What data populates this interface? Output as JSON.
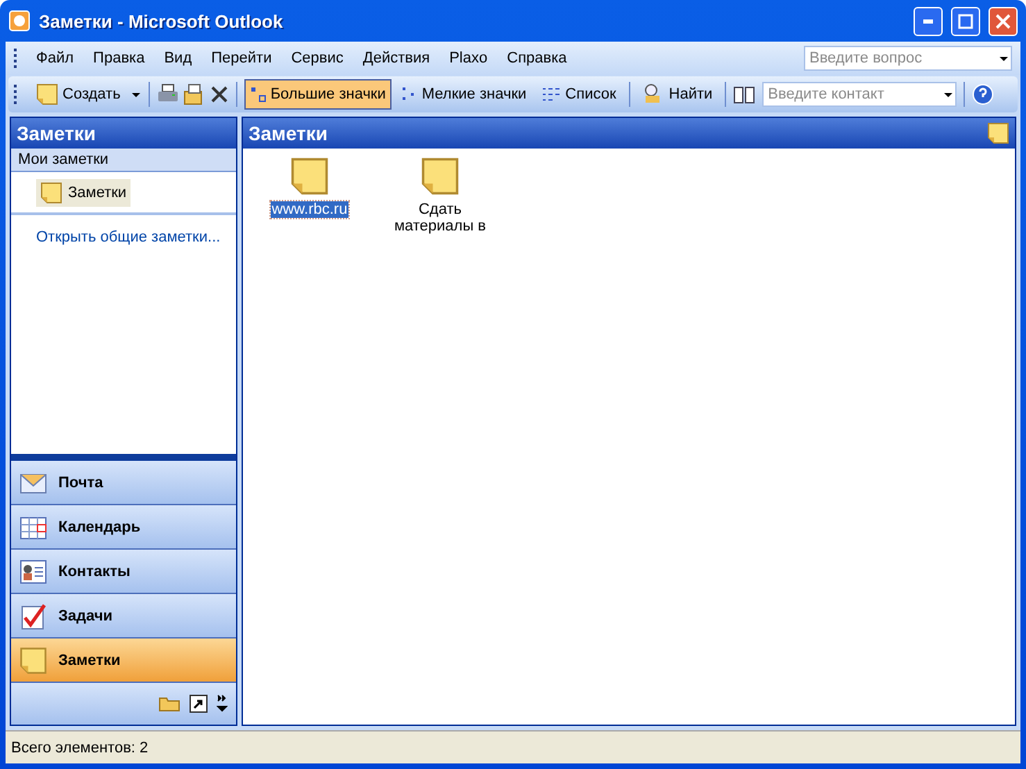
{
  "window": {
    "title": "Заметки - Microsoft Outlook"
  },
  "menu": {
    "items": [
      "Файл",
      "Правка",
      "Вид",
      "Перейти",
      "Сервис",
      "Действия",
      "Plaxo",
      "Справка"
    ],
    "question": {
      "placeholder": "Введите вопрос"
    }
  },
  "toolbar": {
    "items": [
      {
        "kind": "new",
        "label": "Создать"
      },
      {
        "kind": "print"
      },
      {
        "kind": "move"
      },
      {
        "kind": "delete"
      },
      {
        "kind": "large-view",
        "label": "Большие значки",
        "selected": true
      },
      {
        "kind": "small-view",
        "label": "Мелкие значки",
        "selected": false
      },
      {
        "kind": "list-view",
        "label": "Список",
        "selected": false
      },
      {
        "kind": "find",
        "label": "Найти"
      },
      {
        "kind": "book"
      }
    ],
    "contact": {
      "placeholder": "Введите контакт"
    }
  },
  "sidebar": {
    "title": "Заметки",
    "section": "Мои заметки",
    "folders": [
      {
        "label": "Заметки",
        "selected": true
      }
    ],
    "link": "Открыть общие заметки...",
    "nav": [
      {
        "kind": "mail",
        "label": "Почта",
        "selected": false
      },
      {
        "kind": "calendar",
        "label": "Календарь",
        "selected": false
      },
      {
        "kind": "contacts",
        "label": "Контакты",
        "selected": false
      },
      {
        "kind": "tasks",
        "label": "Задачи",
        "selected": false
      },
      {
        "kind": "notes",
        "label": "Заметки",
        "selected": true
      }
    ]
  },
  "main": {
    "title": "Заметки",
    "notes": [
      {
        "label": "www.rbc.ru",
        "selected": true
      },
      {
        "label": "Сдать материалы в",
        "selected": false
      }
    ]
  },
  "status_bar": {
    "text": "Всего элементов: 2"
  }
}
